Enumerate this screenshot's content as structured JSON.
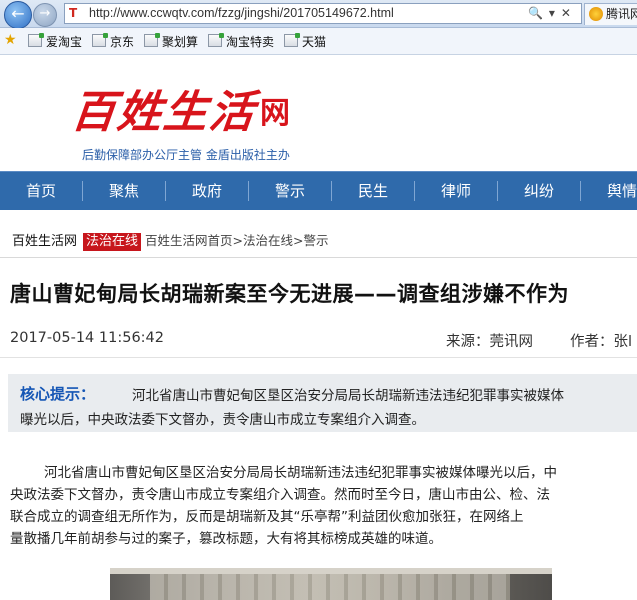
{
  "browser": {
    "url": "http://www.ccwqtv.com/fzzg/jingshi/201705149672.html",
    "tab_label": "腾讯网"
  },
  "favorites": [
    "爱淘宝",
    "京东",
    "聚划算",
    "淘宝特卖",
    "天猫"
  ],
  "site": {
    "logo_text": "百姓生活",
    "logo_suffix": "网",
    "subtitle": "后勤保障部办公厅主管  金盾出版社主办"
  },
  "nav": [
    "首页",
    "聚焦",
    "政府",
    "警示",
    "民生",
    "律师",
    "纠纷",
    "舆情"
  ],
  "breadcrumb": {
    "site": "百姓生活网",
    "tag": "法治在线",
    "path": "百姓生活网首页>法治在线>警示"
  },
  "article": {
    "title": "唐山曹妃甸局长胡瑞新案至今无进展——调查组涉嫌不作为",
    "date": "2017-05-14 11:56:42",
    "source": "来源：莞讯网",
    "author": "作者：张l",
    "summary_label": "核心提示：",
    "summary_line1": "河北省唐山市曹妃甸区垦区治安分局局长胡瑞新违法违纪犯罪事实被媒体",
    "summary_line2": "曝光以后，中央政法委下文督办，责令唐山市成立专案组介入调查。",
    "body": [
      "河北省唐山市曹妃甸区垦区治安分局局长胡瑞新违法违纪犯罪事实被媒体曝光以后，中",
      "央政法委下文督办，责令唐山市成立专案组介入调查。然而时至今日，唐山市由公、检、法",
      "联合成立的调查组无所作为，反而是胡瑞新及其“乐亭帮”利益团伙愈加张狂，在网络上",
      "量散播几年前胡参与过的案子，篡改标题，大有将其标榜成英雄的味道。"
    ]
  },
  "colors": {
    "nav_bg": "#2f6aab",
    "brand_red": "#d8141b",
    "tag_red": "#c7161c",
    "link_blue": "#1556b5"
  }
}
